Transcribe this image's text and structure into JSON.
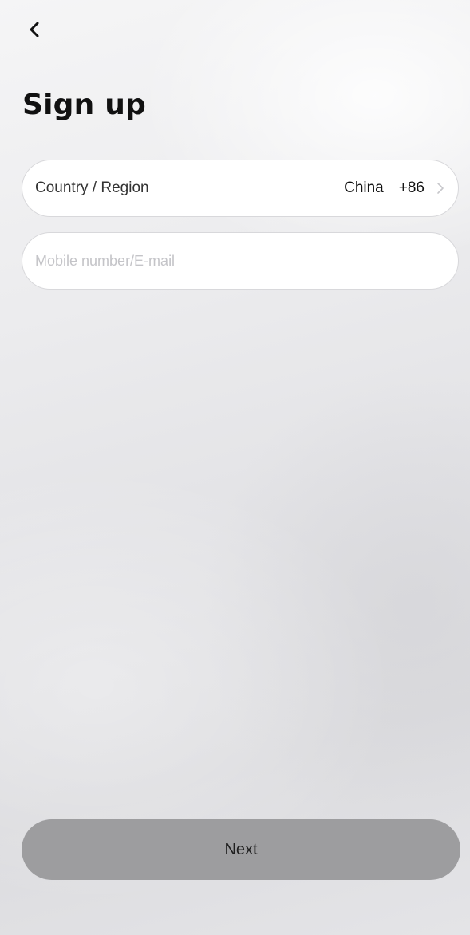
{
  "header": {
    "back_icon": "chevron-left-icon",
    "title": "Sign up"
  },
  "form": {
    "country": {
      "label": "Country / Region",
      "value": "China",
      "code": "+86",
      "icon": "chevron-right-icon"
    },
    "account": {
      "placeholder": "Mobile number/E-mail",
      "value": ""
    }
  },
  "actions": {
    "next_label": "Next"
  },
  "colors": {
    "title": "#111111",
    "field_background": "#ffffff",
    "field_border": "#d8d8db",
    "placeholder": "#c4c4c8",
    "next_button_background": "#9d9d9f",
    "next_button_text": "#1f1f1f"
  }
}
